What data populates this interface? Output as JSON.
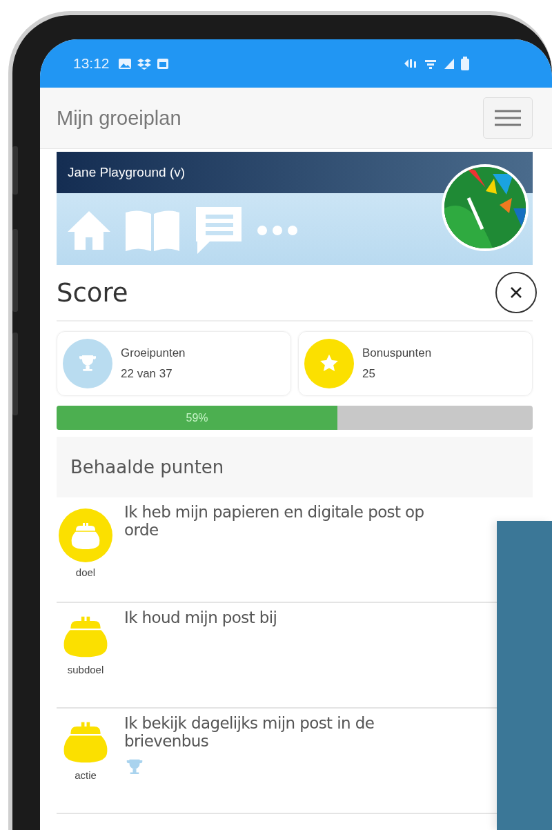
{
  "status_bar": {
    "time": "13:12"
  },
  "header": {
    "title": "Mijn groeiplan"
  },
  "profile": {
    "name": "Jane Playground (v)"
  },
  "score": {
    "title": "Score",
    "cards": [
      {
        "kind": "trophy",
        "color": "#b9dcf0",
        "label": "Groeipunten",
        "value": "22 van 37"
      },
      {
        "kind": "star",
        "color": "#fbe000",
        "label": "Bonuspunten",
        "value": "25"
      }
    ],
    "progress": {
      "level": 0.59,
      "label": "59%"
    }
  },
  "achieved": {
    "title": "Behaalde punten",
    "items": [
      {
        "kind": "outlined",
        "type_label": "doel",
        "text": "Ik heb mijn papieren en digitale post op orde",
        "trophy": false
      },
      {
        "kind": "filled",
        "type_label": "subdoel",
        "text": "Ik houd mijn post bij",
        "trophy": false
      },
      {
        "kind": "filled",
        "type_label": "actie",
        "text": "Ik bekijk dagelijks mijn post in de brievenbus",
        "trophy": true
      }
    ]
  }
}
